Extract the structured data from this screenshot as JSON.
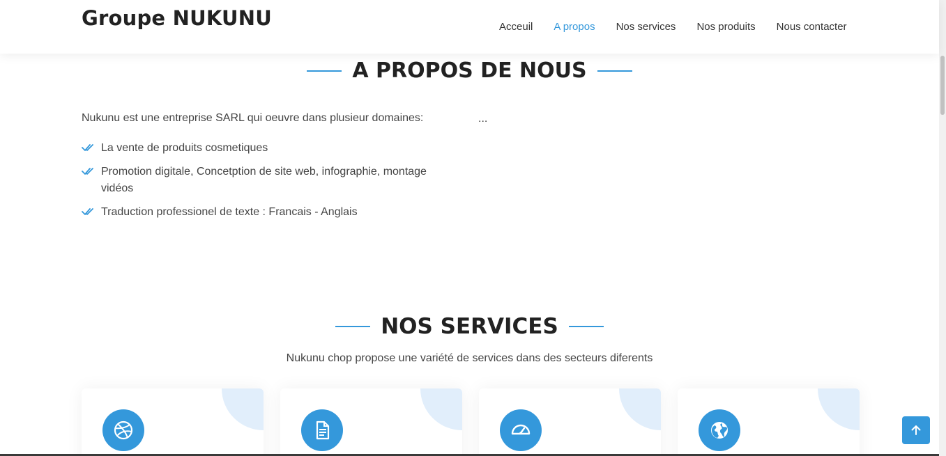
{
  "header": {
    "logo": "Groupe NUKUNU",
    "nav": [
      {
        "label": "Acceuil",
        "active": false
      },
      {
        "label": "A propos",
        "active": true
      },
      {
        "label": "Nos services",
        "active": false
      },
      {
        "label": "Nos produits",
        "active": false
      },
      {
        "label": "Nous contacter",
        "active": false
      }
    ]
  },
  "about": {
    "title": "A PROPOS DE NOUS",
    "intro": "Nukunu est une entreprise SARL qui oeuvre dans plusieur domaines:",
    "ellipsis": "...",
    "items": [
      "La vente de produits cosmetiques",
      "Promotion digitale, Concetption de site web, infographie, montage vidéos",
      "Traduction professionel de texte : Francais - Anglais"
    ]
  },
  "services": {
    "title": "NOS SERVICES",
    "subtitle": "Nukunu chop propose une variété de services dans des secteurs diferents",
    "cards": [
      {
        "icon": "dribbble-icon"
      },
      {
        "icon": "document-icon"
      },
      {
        "icon": "speedometer-icon"
      },
      {
        "icon": "globe-icon"
      }
    ]
  },
  "colors": {
    "accent": "#3498db",
    "heading": "#222222",
    "text": "#444444",
    "card_corner": "#e1eefb"
  },
  "icons": {
    "check": "double-check-icon",
    "back_to_top": "arrow-up-icon"
  }
}
